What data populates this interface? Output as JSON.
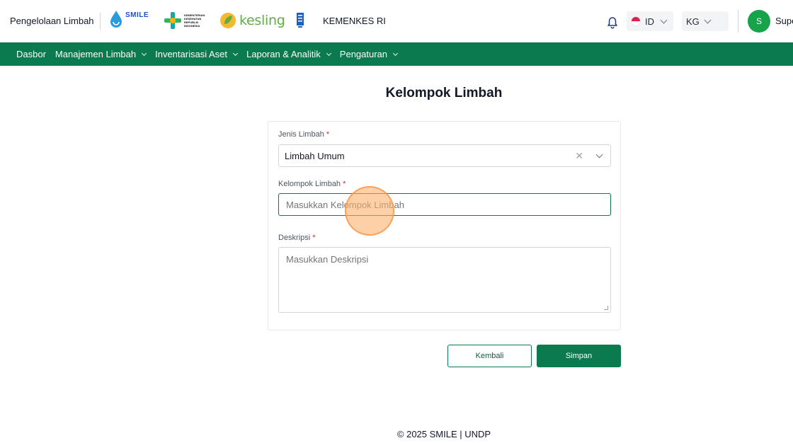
{
  "header": {
    "app_name": "Pengelolaan Limbah",
    "logos": {
      "smile": "SMILE",
      "kemenkes_lines": [
        "KEMENTERIAN",
        "KESEHATAN",
        "REPUBLIK",
        "INDONESIA"
      ],
      "kesling": "kesling"
    },
    "org_label": "KEMENKES RI",
    "language": "ID",
    "unit": "KG",
    "avatar_initial": "S",
    "user_name": "Supe"
  },
  "nav": {
    "items": [
      {
        "label": "Dasbor",
        "has_dropdown": false
      },
      {
        "label": "Manajemen Limbah",
        "has_dropdown": true
      },
      {
        "label": "Inventarisasi Aset",
        "has_dropdown": true
      },
      {
        "label": "Laporan & Analitik",
        "has_dropdown": true
      },
      {
        "label": "Pengaturan",
        "has_dropdown": true
      }
    ]
  },
  "page": {
    "title": "Kelompok Limbah"
  },
  "form": {
    "jenis_label": "Jenis Limbah",
    "jenis_value": "Limbah Umum",
    "kelompok_label": "Kelompok Limbah",
    "kelompok_placeholder": "Masukkan Kelompok Limbah",
    "deskripsi_label": "Deskripsi",
    "deskripsi_placeholder": "Masukkan Deskripsi",
    "required_mark": "*"
  },
  "actions": {
    "back_label": "Kembali",
    "save_label": "Simpan"
  },
  "footer": {
    "text": "© 2025 SMILE | UNDP"
  },
  "colors": {
    "brand_green": "#0b7a4f",
    "avatar_green": "#16a34a",
    "required_red": "#dc2626"
  },
  "icons": [
    "bell-icon",
    "flag-id-icon",
    "chevron-down-icon",
    "clear-icon"
  ]
}
